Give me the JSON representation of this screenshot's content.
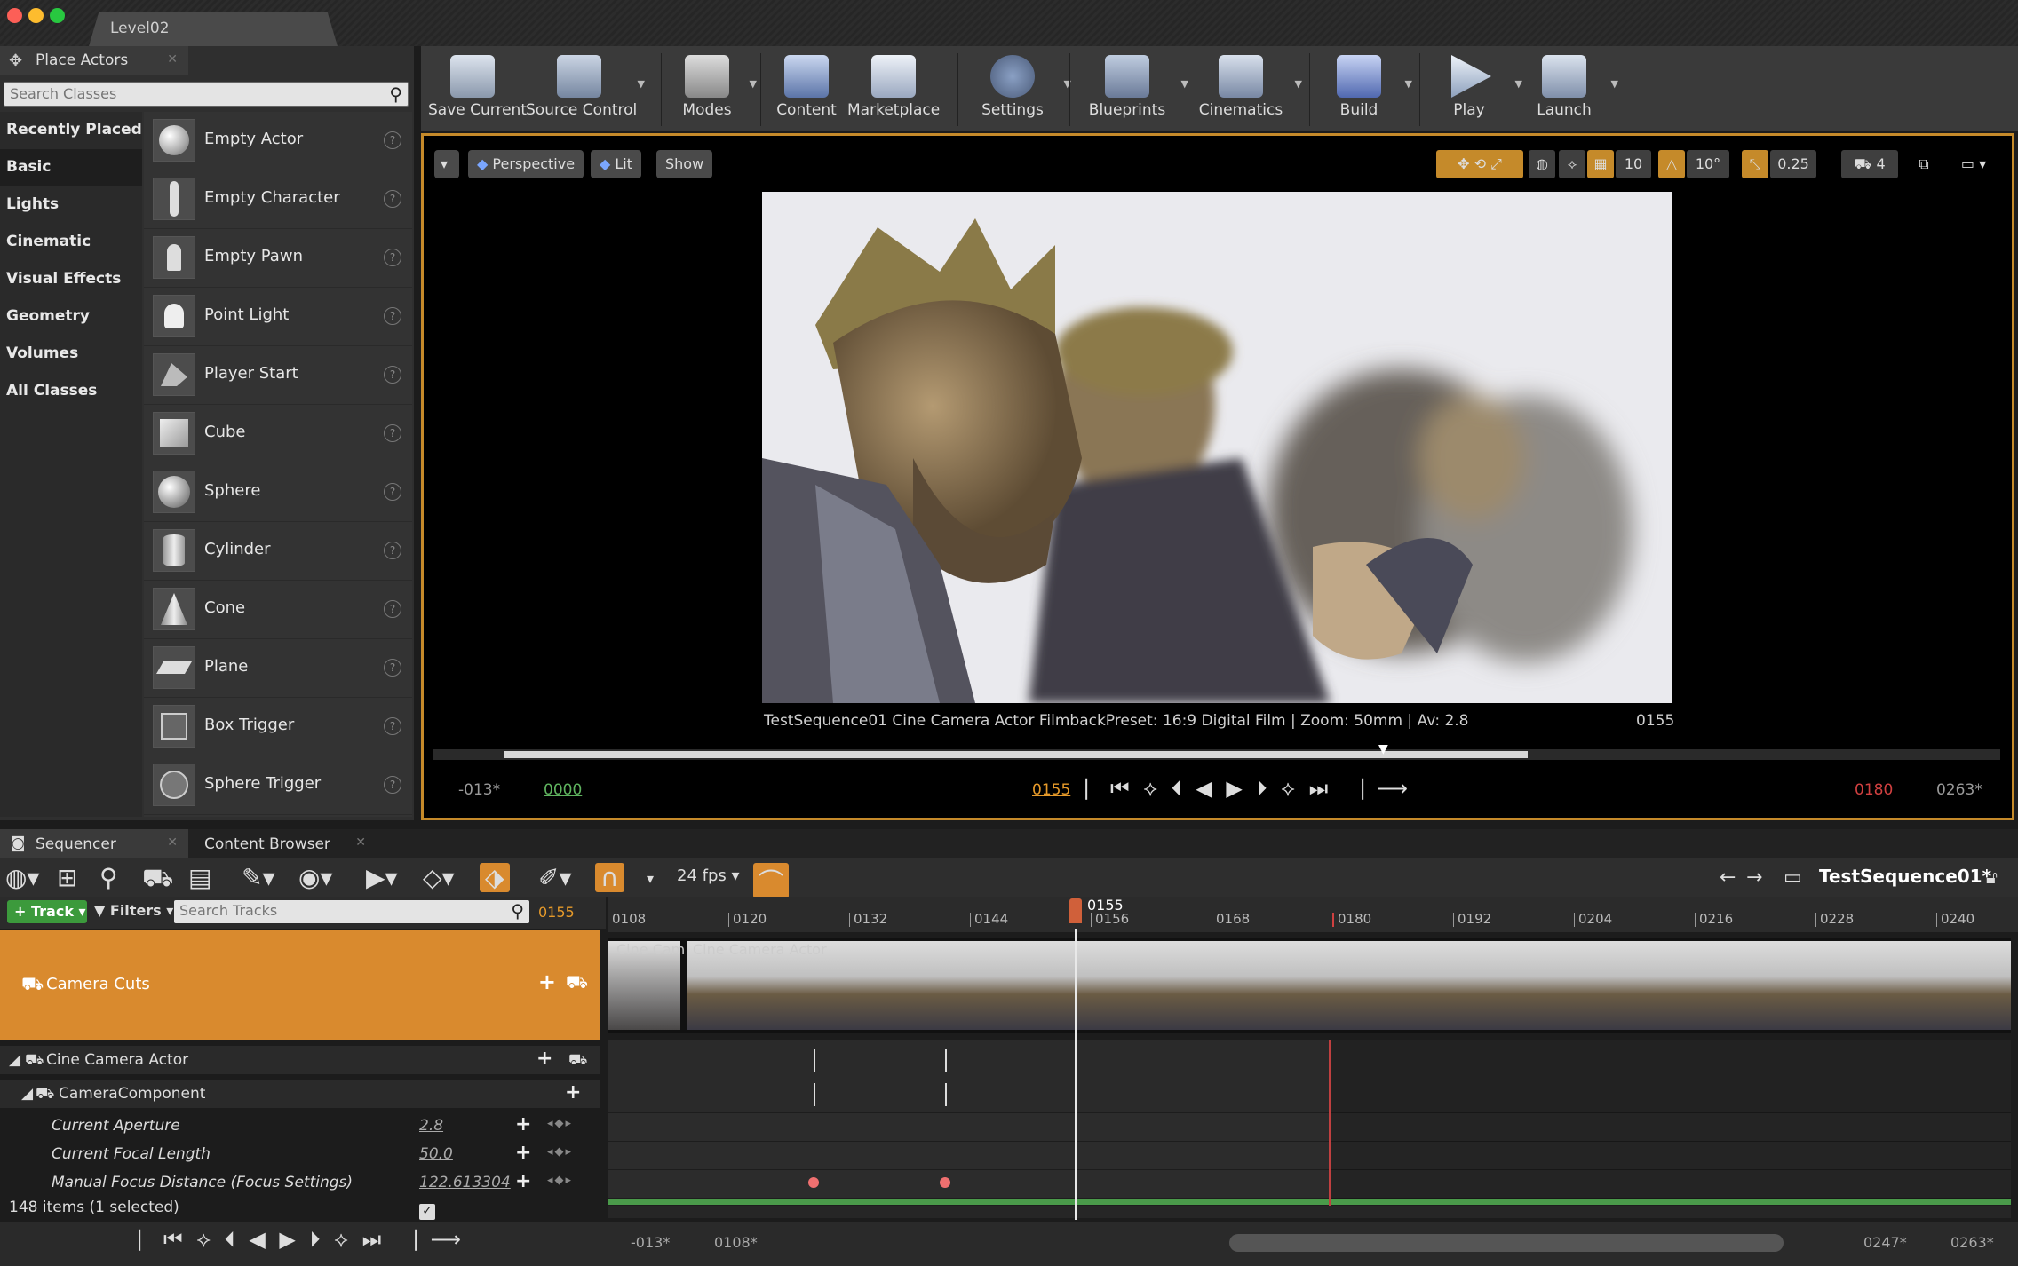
{
  "window": {
    "tab_title": "Level02"
  },
  "place_actors": {
    "tab_label": "Place Actors",
    "search_placeholder": "Search Classes",
    "categories": [
      "Recently Placed",
      "Basic",
      "Lights",
      "Cinematic",
      "Visual Effects",
      "Geometry",
      "Volumes",
      "All Classes"
    ],
    "selected_category": "Basic",
    "actors": [
      "Empty Actor",
      "Empty Character",
      "Empty Pawn",
      "Point Light",
      "Player Start",
      "Cube",
      "Sphere",
      "Cylinder",
      "Cone",
      "Plane",
      "Box Trigger",
      "Sphere Trigger"
    ]
  },
  "toolbar": {
    "save_current": "Save Current",
    "source_control": "Source Control",
    "modes": "Modes",
    "content": "Content",
    "marketplace": "Marketplace",
    "settings": "Settings",
    "blueprints": "Blueprints",
    "cinematics": "Cinematics",
    "build": "Build",
    "play": "Play",
    "launch": "Launch"
  },
  "viewport": {
    "perspective": "Perspective",
    "lit": "Lit",
    "show": "Show",
    "grid_snap": "10",
    "rot_snap": "10°",
    "scale_snap": "0.25",
    "cam_speed": "4",
    "info": "TestSequence01  Cine Camera Actor      FilmbackPreset: 16:9 Digital Film | Zoom: 50mm | Av: 2.8",
    "frame": "0155",
    "scrub_progress": 0.65,
    "start_out": "-013*",
    "start_in": "0000",
    "current": "0155",
    "end_in": "0180",
    "end_out": "0263*"
  },
  "sequencer": {
    "tab_sequencer": "Sequencer",
    "tab_content_browser": "Content Browser",
    "fps": "24 fps",
    "sequence_name": "TestSequence01*",
    "track_button": "Track",
    "filters": "Filters",
    "search_placeholder": "Search Tracks",
    "current_frame": "0155",
    "playhead_label": "0155",
    "ruler_ticks": [
      "0108",
      "0120",
      "0132",
      "0144",
      "0156",
      "0168",
      "0180",
      "0192",
      "0204",
      "0216",
      "0228",
      "0240"
    ],
    "camera_cuts_label": "Camera Cuts",
    "strip_label_1": "Cine Cam",
    "strip_label_2": "Cine Camera Actor",
    "tracks": [
      {
        "label": "Cine Camera Actor",
        "value": ""
      },
      {
        "label": "CameraComponent",
        "value": ""
      },
      {
        "label": "Current Aperture",
        "value": "2.8"
      },
      {
        "label": "Current Focal Length",
        "value": "50.0"
      },
      {
        "label": "Manual Focus Distance (Focus Settings)",
        "value": "122.613304"
      }
    ],
    "status": "148 items (1 selected)",
    "bottom_left_1": "-013*",
    "bottom_left_2": "0108*",
    "bottom_right_1": "0247*",
    "bottom_right_2": "0263*"
  },
  "colors": {
    "accent": "#d98a2e",
    "track_button": "#3c9a3c",
    "key": "#f07070"
  }
}
